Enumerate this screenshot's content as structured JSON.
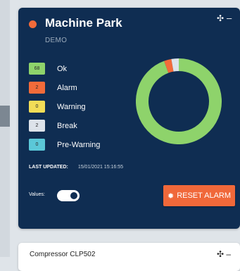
{
  "machine_park": {
    "title": "Machine Park",
    "subtitle": "DEMO",
    "status_color": "#f26b3a",
    "move_icon": "move-icon",
    "minimize_icon": "minimize-icon",
    "legend": [
      {
        "count": "68",
        "label": "Ok",
        "color": "#8ed36b"
      },
      {
        "count": "2",
        "label": "Alarm",
        "color": "#f26b3a"
      },
      {
        "count": "0",
        "label": "Warning",
        "color": "#f3dd57"
      },
      {
        "count": "2",
        "label": "Break",
        "color": "#dde3ea"
      },
      {
        "count": "0",
        "label": "Pre-Warning",
        "color": "#5bc8d8"
      }
    ],
    "last_updated_label": "LAST UPDATED:",
    "last_updated_value": "15/01/2021 15:16:55",
    "values_label": "Values:",
    "values_toggle_on": true,
    "reset_button_label": "RESET ALARM",
    "reset_button_icon": "alarm-icon"
  },
  "compressor_card": {
    "title": "Compressor CLP502",
    "icons": "✣ –"
  }
}
